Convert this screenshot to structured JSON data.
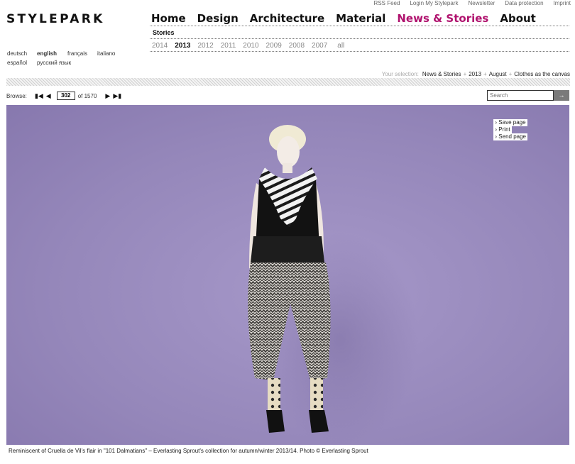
{
  "util_links": [
    "RSS Feed",
    "Login My Stylepark",
    "Newsletter",
    "Data protection",
    "Imprint"
  ],
  "logo": "STYLEPARK",
  "main_nav": [
    "Home",
    "Design",
    "Architecture",
    "Material",
    "News & Stories",
    "About"
  ],
  "active_nav": "News & Stories",
  "subnav": "Stories",
  "years": [
    "2014",
    "2013",
    "2012",
    "2011",
    "2010",
    "2009",
    "2008",
    "2007",
    "all"
  ],
  "selected_year": "2013",
  "languages": {
    "row1": [
      "deutsch",
      "english",
      "français",
      "italiano"
    ],
    "row2": [
      "español",
      "русский язык"
    ],
    "selected": "english"
  },
  "breadcrumb": {
    "label": "Your selection:",
    "items": [
      "News & Stories",
      "2013",
      "August",
      "Clothes as the canvas"
    ],
    "sep": "+"
  },
  "browse": {
    "label": "Browse:",
    "current": "302",
    "of_text": "of 1570"
  },
  "search": {
    "placeholder": "Search",
    "go_label": "→"
  },
  "tools": [
    "Save page",
    "Print",
    "Send page"
  ],
  "caption": "Reminiscent of Cruella de Vil's flair in \"101 Dalmatians\" – Everlasting Sprout's collection for autumn/winter 2013/14. Photo © Everlasting Sprout",
  "colors": {
    "accent": "#b0136e",
    "backdrop": "#9587ba"
  }
}
